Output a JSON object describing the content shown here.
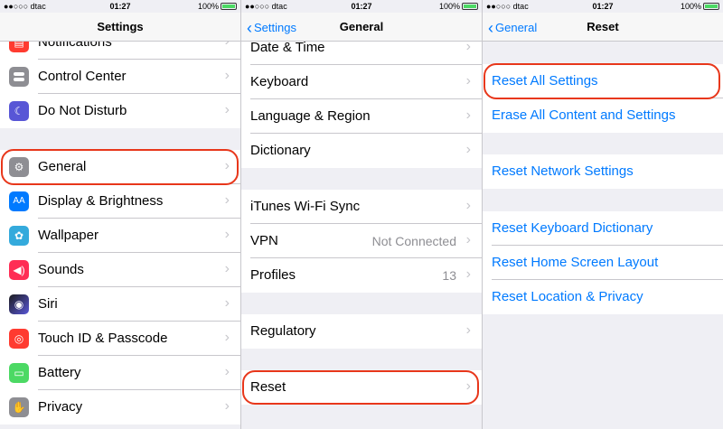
{
  "status": {
    "carrier": "●●○○○ dtac",
    "time": "01:27",
    "battery": "100%"
  },
  "settings": {
    "title": "Settings",
    "items": [
      {
        "label": "Notifications",
        "icon": "notifications-icon",
        "color": "#ff3b30"
      },
      {
        "label": "Control Center",
        "icon": "control-center-icon",
        "color": "#8e8e93"
      },
      {
        "label": "Do Not Disturb",
        "icon": "moon-icon",
        "color": "#5856d6"
      },
      {
        "label": "General",
        "icon": "gear-icon",
        "color": "#8e8e93"
      },
      {
        "label": "Display & Brightness",
        "icon": "display-icon",
        "color": "#007aff"
      },
      {
        "label": "Wallpaper",
        "icon": "wallpaper-icon",
        "color": "#34aadc"
      },
      {
        "label": "Sounds",
        "icon": "sounds-icon",
        "color": "#ff2d55"
      },
      {
        "label": "Siri",
        "icon": "siri-icon",
        "color": "#1c1c1e"
      },
      {
        "label": "Touch ID & Passcode",
        "icon": "fingerprint-icon",
        "color": "#ff3b30"
      },
      {
        "label": "Battery",
        "icon": "battery-icon",
        "color": "#4cd964"
      },
      {
        "label": "Privacy",
        "icon": "hand-icon",
        "color": "#8e8e93"
      }
    ]
  },
  "general": {
    "back": "Settings",
    "title": "General",
    "items": [
      {
        "label": "Date & Time"
      },
      {
        "label": "Keyboard"
      },
      {
        "label": "Language & Region"
      },
      {
        "label": "Dictionary"
      },
      {
        "label": "iTunes Wi-Fi Sync"
      },
      {
        "label": "VPN",
        "value": "Not Connected"
      },
      {
        "label": "Profiles",
        "value": "13"
      },
      {
        "label": "Regulatory"
      },
      {
        "label": "Reset"
      }
    ]
  },
  "reset": {
    "back": "General",
    "title": "Reset",
    "items": [
      {
        "label": "Reset All Settings"
      },
      {
        "label": "Erase All Content and Settings"
      },
      {
        "label": "Reset Network Settings"
      },
      {
        "label": "Reset Keyboard Dictionary"
      },
      {
        "label": "Reset Home Screen Layout"
      },
      {
        "label": "Reset Location & Privacy"
      }
    ]
  },
  "colors": {
    "accent": "#007aff",
    "highlight": "#e8371b",
    "background": "#efeff4"
  }
}
